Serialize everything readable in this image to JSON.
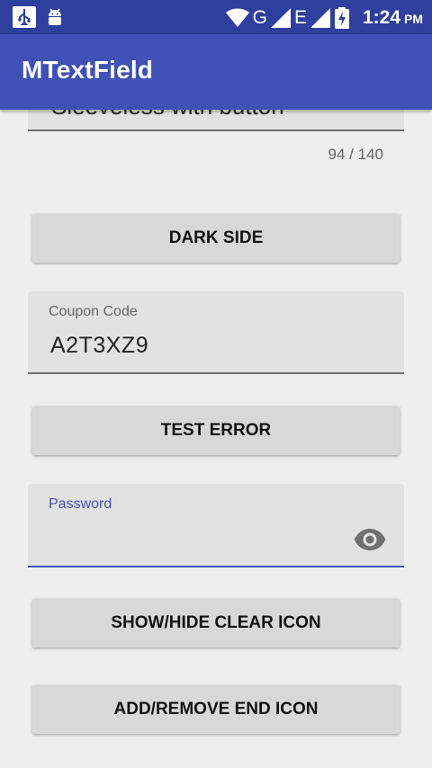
{
  "status_bar": {
    "network_letter_1": "G",
    "network_letter_2": "E",
    "time": "1:24",
    "ampm": "PM",
    "icons": [
      "usb-icon",
      "android-debug-icon",
      "wifi-icon",
      "signal-icon",
      "battery-charging-icon"
    ]
  },
  "app_bar": {
    "title": "MTextField"
  },
  "top_field": {
    "value": "Sleeveless with button",
    "counter": "94 / 140"
  },
  "buttons": {
    "dark_side": "DARK SIDE",
    "test_error": "TEST ERROR",
    "show_hide_clear": "SHOW/HIDE CLEAR ICON",
    "add_remove_end": "ADD/REMOVE END ICON"
  },
  "coupon_field": {
    "label": "Coupon Code",
    "value": "A2T3XZ9"
  },
  "password_field": {
    "label": "Password",
    "value": "",
    "end_icon": "eye-icon"
  },
  "colors": {
    "primary": "#3f51b5",
    "primary_dark": "#2e3f9e",
    "background": "#eeeeee"
  }
}
